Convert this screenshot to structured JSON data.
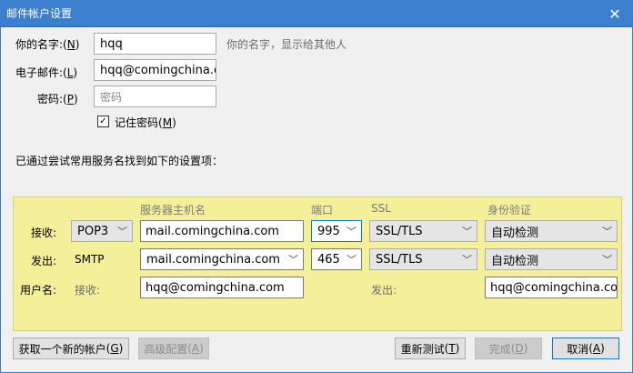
{
  "window": {
    "title": "邮件帐户设置",
    "close_glyph": "✕"
  },
  "form": {
    "name_label": "你的名字:",
    "name_accel": "N",
    "name_value": "hqq",
    "name_hint": "你的名字，显示给其他人",
    "email_label": "电子邮件:",
    "email_accel": "L",
    "email_value": "hqq@comingchina.com",
    "password_label": "密码:",
    "password_accel": "P",
    "password_placeholder": "密码",
    "remember_label": "记住密码",
    "remember_accel": "M",
    "remember_checked": true,
    "status_message": "已通过尝试常用服务名找到如下的设置项："
  },
  "server_table": {
    "headers": {
      "server": "服务器主机名",
      "port": "端口",
      "ssl": "SSL",
      "auth": "身份验证"
    },
    "incoming": {
      "row_label": "接收:",
      "protocol": "POP3",
      "server": "mail.comingchina.com",
      "port": "995",
      "ssl": "SSL/TLS",
      "auth": "自动检测"
    },
    "outgoing": {
      "row_label": "发出:",
      "protocol": "SMTP",
      "server": "mail.comingchina.com",
      "port": "465",
      "ssl": "SSL/TLS",
      "auth": "自动检测"
    },
    "username": {
      "row_label": "用户名:",
      "incoming_label": "接收:",
      "incoming_value": "hqq@comingchina.com",
      "outgoing_label": "发出:",
      "outgoing_value": "hqq@comingchina.com"
    }
  },
  "buttons": {
    "new_account": "获取一个新的帐户",
    "new_account_accel": "G",
    "advanced": "高级配置",
    "advanced_accel": "A",
    "retest": "重新测试",
    "retest_accel": "T",
    "done": "完成",
    "done_accel": "D",
    "cancel": "取消",
    "cancel_accel": "A"
  },
  "icons": {
    "dropdown": "chevron-down-icon",
    "check": "check-icon"
  }
}
